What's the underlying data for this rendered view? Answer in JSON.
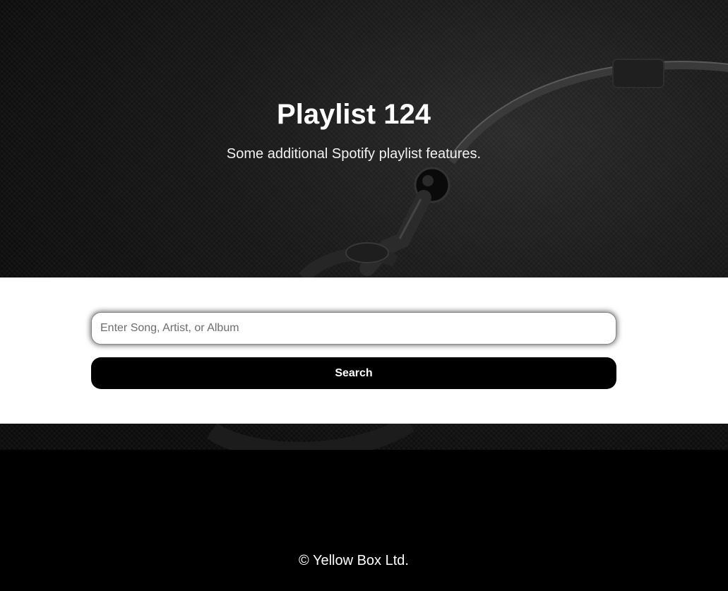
{
  "hero": {
    "title": "Playlist 124",
    "subtitle": "Some additional Spotify playlist features.",
    "background_image": "headphones-photo"
  },
  "search": {
    "placeholder": "Enter Song, Artist, or Album",
    "value": "",
    "button_label": "Search"
  },
  "footer": {
    "copyright": "© Yellow Box Ltd."
  },
  "colors": {
    "hero_bg": "#111111",
    "panel_bg": "#ffffff",
    "button_bg": "#000000",
    "button_text": "#ffffff",
    "footer_bg": "#000000"
  }
}
